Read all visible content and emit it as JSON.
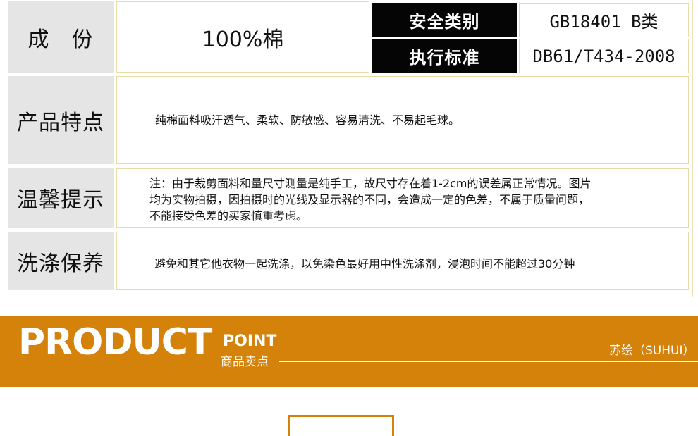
{
  "spec": {
    "composition_label": "成　份",
    "composition_value": "100%棉",
    "safety_label": "安全类别",
    "safety_value": "GB18401 B类",
    "standard_label": "执行标准",
    "standard_value": "DB61/T434-2008"
  },
  "features": {
    "label": "产品特点",
    "text": "纯棉面料吸汗透气、柔软、防敏感、容易清洗、不易起毛球。"
  },
  "notice": {
    "label": "温馨提示",
    "line1": "注：由于裁剪面料和量尺寸测量是纯手工，故尺寸存在着1-2cm的误差属正常情况。图片",
    "line2": "均为实物拍摄，因拍摄时的光线及显示器的不同，会造成一定的色差，不属于质量问题，",
    "line3": "不能接受色差的买家慎重考虑。"
  },
  "washing": {
    "label": "洗涤保养",
    "text": "避免和其它他衣物一起洗涤，以免染色最好用中性洗涤剂，浸泡时间不能超过30分钟"
  },
  "banner": {
    "title": "PRODUCT",
    "point": "POINT",
    "subtitle": "商品卖点",
    "brand": "苏绘（SUHUI）",
    "color": "#d5820a"
  }
}
